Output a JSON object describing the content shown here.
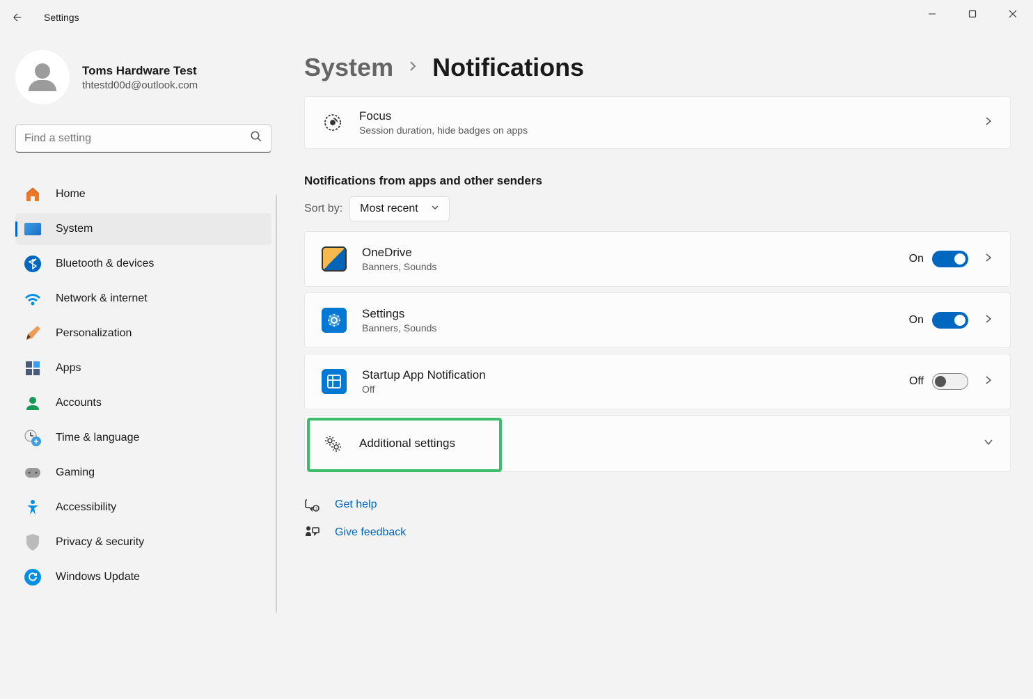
{
  "title": "Settings",
  "user": {
    "name": "Toms Hardware Test",
    "email": "thtestd00d@outlook.com"
  },
  "search": {
    "placeholder": "Find a setting"
  },
  "nav": {
    "home": "Home",
    "system": "System",
    "bluetooth": "Bluetooth & devices",
    "network": "Network & internet",
    "personalization": "Personalization",
    "apps": "Apps",
    "accounts": "Accounts",
    "time": "Time & language",
    "gaming": "Gaming",
    "accessibility": "Accessibility",
    "privacy": "Privacy & security",
    "update": "Windows Update"
  },
  "breadcrumb": {
    "parent": "System",
    "current": "Notifications"
  },
  "focus": {
    "title": "Focus",
    "sub": "Session duration, hide badges on apps"
  },
  "section_title": "Notifications from apps and other senders",
  "sort": {
    "label": "Sort by:",
    "value": "Most recent"
  },
  "apps": [
    {
      "name": "OneDrive",
      "sub": "Banners, Sounds",
      "state": "On",
      "on": true
    },
    {
      "name": "Settings",
      "sub": "Banners, Sounds",
      "state": "On",
      "on": true
    },
    {
      "name": "Startup App Notification",
      "sub": "Off",
      "state": "Off",
      "on": false
    }
  ],
  "additional": "Additional settings",
  "footer": {
    "help": "Get help",
    "feedback": "Give feedback"
  }
}
